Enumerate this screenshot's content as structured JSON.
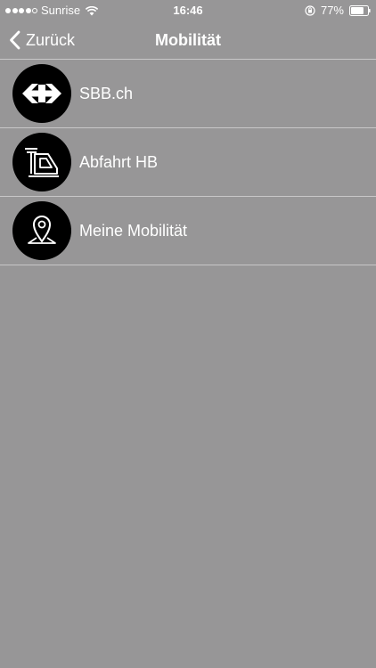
{
  "status_bar": {
    "carrier": "Sunrise",
    "time": "16:46",
    "battery_percent": "77%",
    "signal_bars_filled": 4,
    "signal_bars_total": 5,
    "battery_level": 0.77
  },
  "nav": {
    "back_label": "Zurück",
    "title": "Mobilität"
  },
  "menu": {
    "items": [
      {
        "label": "SBB.ch",
        "icon": "sbb-logo-icon"
      },
      {
        "label": "Abfahrt HB",
        "icon": "train-icon"
      },
      {
        "label": "Meine Mobilität",
        "icon": "location-pin-icon"
      }
    ]
  },
  "colors": {
    "background": "#979697",
    "separator": "#c8c7c8",
    "icon_circle": "#000000",
    "text": "#ffffff"
  }
}
